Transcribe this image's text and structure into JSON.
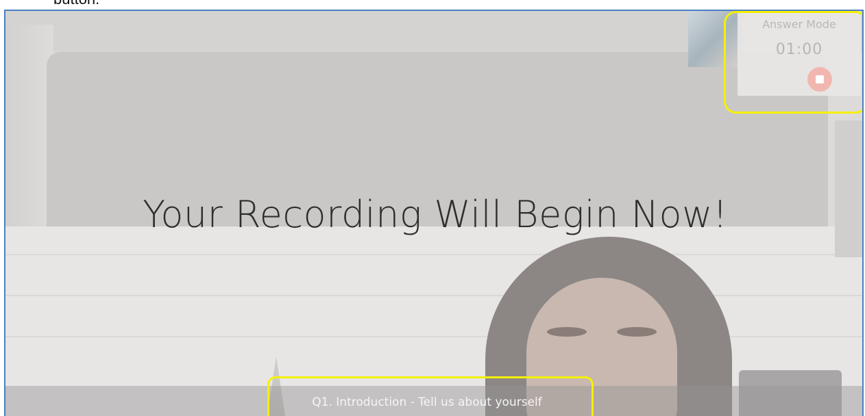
{
  "document": {
    "fragment_text": "button."
  },
  "answer_panel": {
    "mode_label": "Answer Mode",
    "timer": "01:00",
    "stop_icon": "stop-icon"
  },
  "main": {
    "headline": "Your Recording Will Begin Now!"
  },
  "question": {
    "text": "Q1. Introduction - Tell us about yourself"
  },
  "colors": {
    "highlight": "#f5f000",
    "frame_border": "#4a7fc1",
    "stop_button": "#f2b6b0"
  }
}
